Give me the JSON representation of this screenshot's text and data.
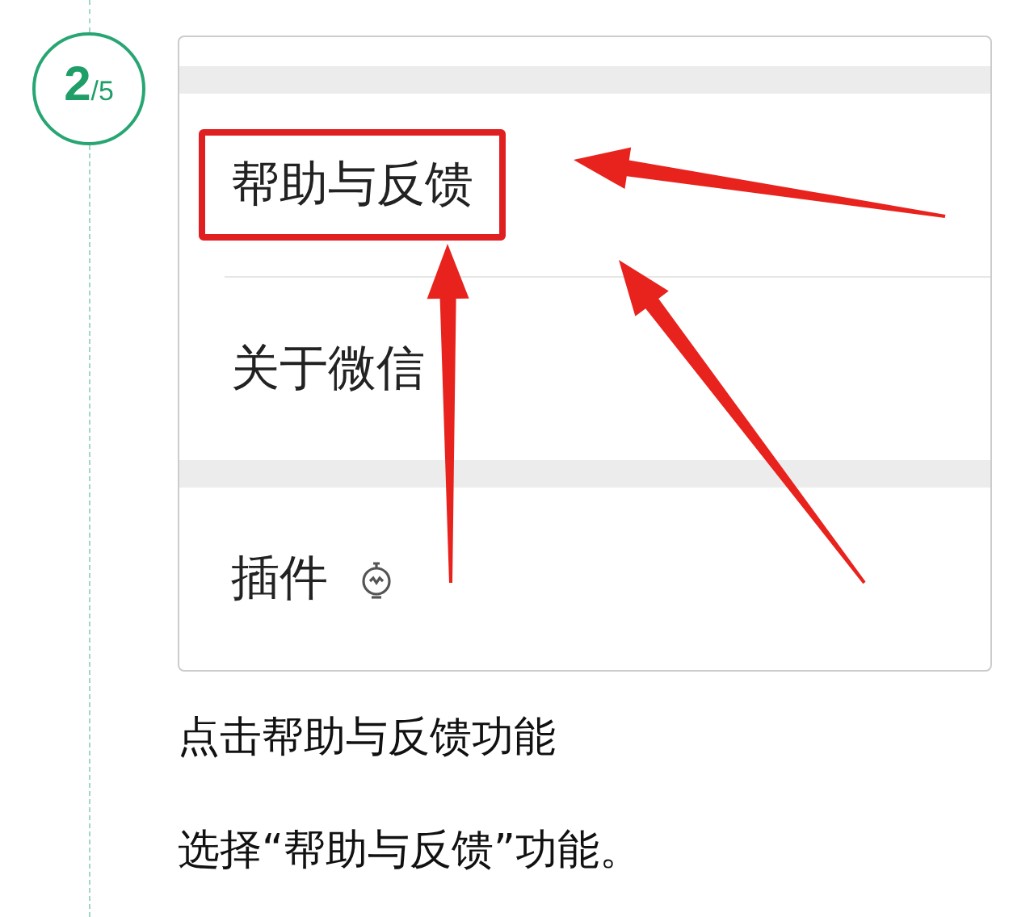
{
  "step": {
    "current": "2",
    "total": "/5"
  },
  "screenshot": {
    "rows": [
      {
        "kind": "item",
        "label": "帮助与反馈",
        "highlighted": true
      },
      {
        "kind": "item",
        "label": "关于微信",
        "highlighted": false
      },
      {
        "kind": "gap"
      },
      {
        "kind": "item-icon",
        "label": "插件",
        "highlighted": false
      }
    ]
  },
  "captions": [
    "点击帮助与反馈功能",
    "选择“帮助与反馈”功能。"
  ]
}
